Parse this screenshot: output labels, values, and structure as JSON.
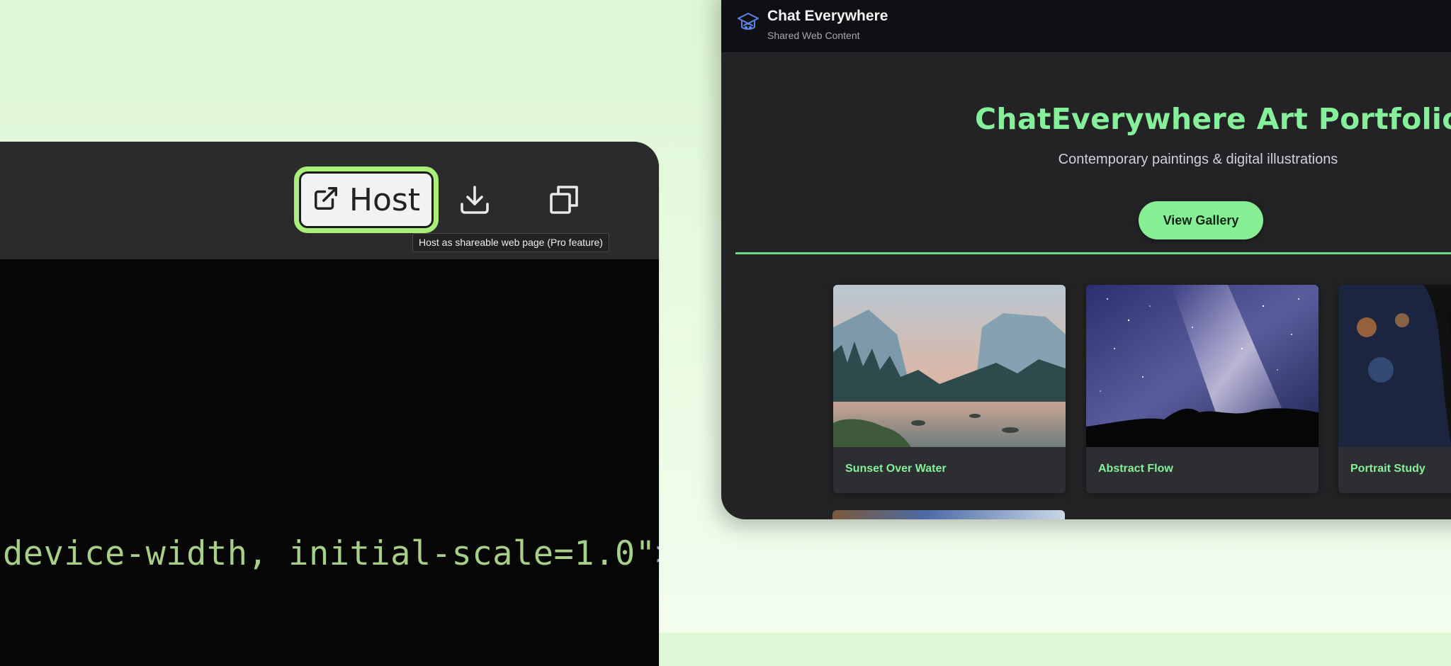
{
  "editor": {
    "host_button_label": "Host",
    "tooltip": "Host as shareable web page (Pro feature)",
    "code_text": "device-width, initial-scale=1.0\"",
    "code_tag_end": ">",
    "icons": [
      "external-link-icon",
      "download-icon",
      "copy-icon"
    ]
  },
  "preview": {
    "app_title": "Chat Everywhere",
    "app_subtitle": "Shared Web Content",
    "hero_title": "ChatEverywhere Art Portfolio",
    "hero_subtitle": "Contemporary paintings & digital illustrations",
    "cta_label": "View Gallery",
    "cards": [
      {
        "caption": "Sunset Over Water"
      },
      {
        "caption": "Abstract Flow"
      },
      {
        "caption": "Portrait Study"
      }
    ]
  },
  "colors": {
    "accent_green": "#86ef9a",
    "highlight_outline": "#a8f07a",
    "background": "#def7d4",
    "editor_bg": "#060606",
    "toolbar_bg": "#2b2b2b"
  }
}
